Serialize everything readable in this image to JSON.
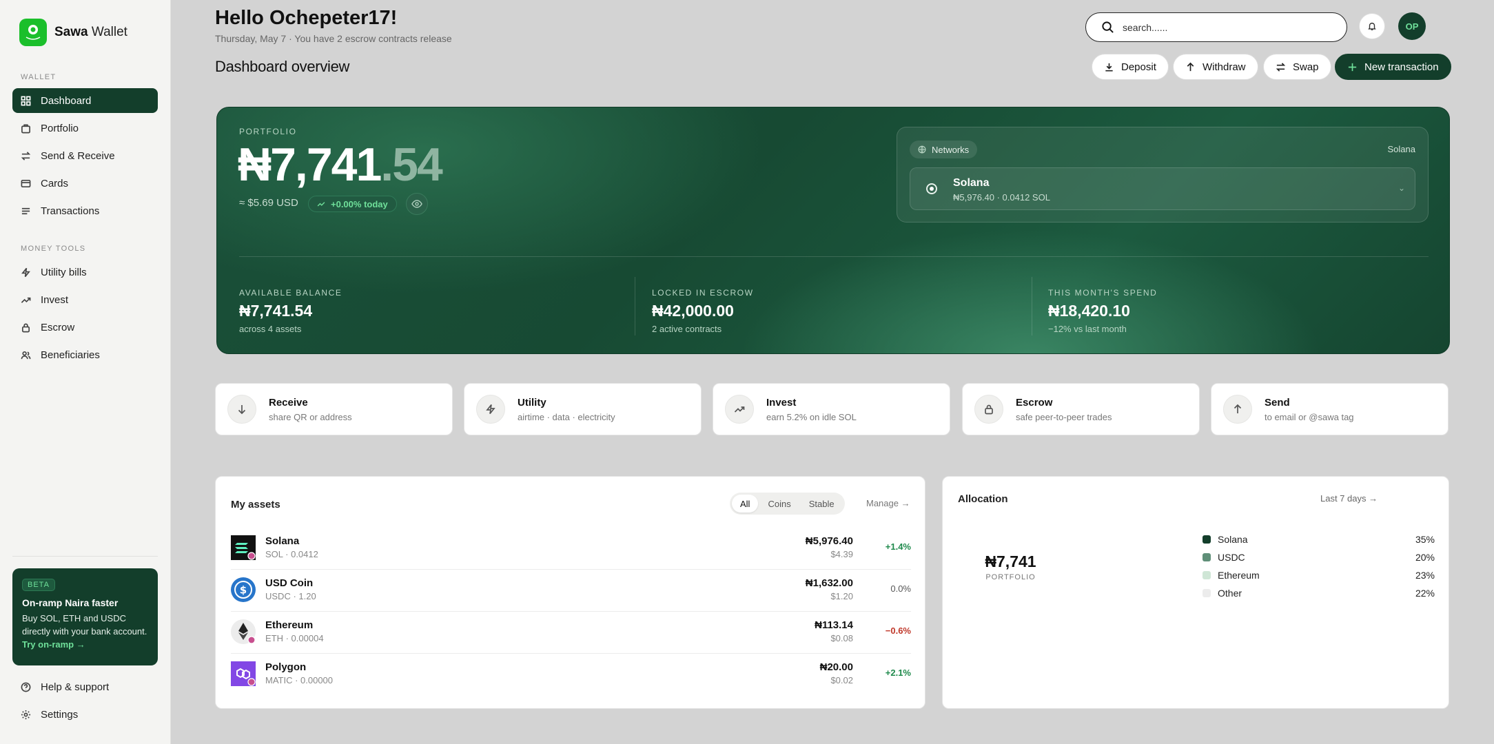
{
  "brand": {
    "name_bold": "Sawa",
    "name_rest": " Wallet",
    "logo_text": "SAWA WALLET"
  },
  "sidebar": {
    "wallet_label": "WALLET",
    "wallet_items": [
      {
        "label": "Dashboard",
        "icon": "grid-icon",
        "active": true
      },
      {
        "label": "Portfolio",
        "icon": "briefcase-icon"
      },
      {
        "label": "Send & Receive",
        "icon": "arrows-exchange-icon"
      },
      {
        "label": "Cards",
        "icon": "card-icon"
      },
      {
        "label": "Transactions",
        "icon": "list-icon"
      }
    ],
    "tools_label": "MONEY TOOLS",
    "tools_items": [
      {
        "label": "Utility bills",
        "icon": "bolt-icon"
      },
      {
        "label": "Invest",
        "icon": "trend-up-icon"
      },
      {
        "label": "Escrow",
        "icon": "lock-icon"
      },
      {
        "label": "Beneficiaries",
        "icon": "users-icon"
      }
    ],
    "promo": {
      "badge": "BETA",
      "title": "On-ramp Naira faster",
      "body": "Buy SOL, ETH and USDC directly with your bank account.",
      "link": "Try on-ramp →"
    },
    "footer_items": [
      {
        "label": "Help & support",
        "icon": "help-icon"
      },
      {
        "label": "Settings",
        "icon": "gear-icon"
      }
    ]
  },
  "header": {
    "greeting": "Hello Ochepeter17!",
    "subtitle": "Thursday, May 7 · You have 2 escrow contracts  release",
    "search_placeholder": "search......",
    "avatar_initials": "OP",
    "page_title": "Dashboard overview",
    "actions": {
      "deposit": "Deposit",
      "withdraw": "Withdraw",
      "swap": "Swap",
      "new_transaction": "New transaction"
    }
  },
  "hero": {
    "portfolio_label": "PORTFOLIO",
    "balance_main": "₦7,741",
    "balance_decimal": ".54",
    "usd": "≈ $5.69 USD",
    "today": "+0.00% today",
    "networks_label": "Networks",
    "network_current": "Solana",
    "network_name": "Solana",
    "network_sub": "₦5,976.40 · 0.0412 SOL",
    "stats": [
      {
        "label": "AVAILABLE BALANCE",
        "value": "₦7,741.54",
        "sub": "across 4 assets"
      },
      {
        "label": "LOCKED IN ESCROW",
        "value": "₦42,000.00",
        "sub": "2 active contracts"
      },
      {
        "label": "THIS MONTH'S SPEND",
        "value": "₦18,420.10",
        "sub": "−12% vs last month"
      }
    ]
  },
  "quick_actions": [
    {
      "title": "Receive",
      "sub": "share QR or address",
      "icon": "arrow-down-icon"
    },
    {
      "title": "Utility",
      "sub": "airtime · data · electricity",
      "icon": "bolt-icon"
    },
    {
      "title": "Invest",
      "sub": "earn 5.2% on idle SOL",
      "icon": "trend-up-icon"
    },
    {
      "title": "Escrow",
      "sub": "safe peer-to-peer trades",
      "icon": "lock-icon"
    },
    {
      "title": "Send",
      "sub": "to email or @sawa tag",
      "icon": "arrow-up-icon"
    }
  ],
  "assets": {
    "title": "My assets",
    "filters": [
      "All",
      "Coins",
      "Stable"
    ],
    "active_filter": "All",
    "manage": "Manage →",
    "rows": [
      {
        "name": "Solana",
        "sub": "SOL · 0.0412",
        "value": "₦5,976.40",
        "usd": "$4.39",
        "change": "+1.4%",
        "trend": "pos",
        "icon": "solana-icon"
      },
      {
        "name": "USD Coin",
        "sub": "USDC · 1.20",
        "value": "₦1,632.00",
        "usd": "$1.20",
        "change": "0.0%",
        "trend": "neu",
        "icon": "usdc-icon"
      },
      {
        "name": "Ethereum",
        "sub": "ETH · 0.00004",
        "value": "₦113.14",
        "usd": "$0.08",
        "change": "−0.6%",
        "trend": "neg",
        "icon": "ethereum-icon"
      },
      {
        "name": "Polygon",
        "sub": "MATIC · 0.00000",
        "value": "₦20.00",
        "usd": "$0.02",
        "change": "+2.1%",
        "trend": "pos",
        "icon": "polygon-icon"
      }
    ]
  },
  "allocation": {
    "title": "Allocation",
    "range": "Last 7 days →",
    "center_value": "₦7,741",
    "center_label": "PORTFOLIO",
    "legend": [
      {
        "name": "Solana",
        "pct": "35%",
        "color": "#133e2b"
      },
      {
        "name": "USDC",
        "pct": "20%",
        "color": "#5f8f78"
      },
      {
        "name": "Ethereum",
        "pct": "23%",
        "color": "#cfe6d6"
      },
      {
        "name": "Other",
        "pct": "22%",
        "color": "#ececec"
      }
    ]
  },
  "colors": {
    "brand_dark": "#133e2b",
    "accent_green": "#6fe09a",
    "logo_green": "#1bbf2b",
    "positive": "#1f8a4c",
    "negative": "#c0392b"
  }
}
